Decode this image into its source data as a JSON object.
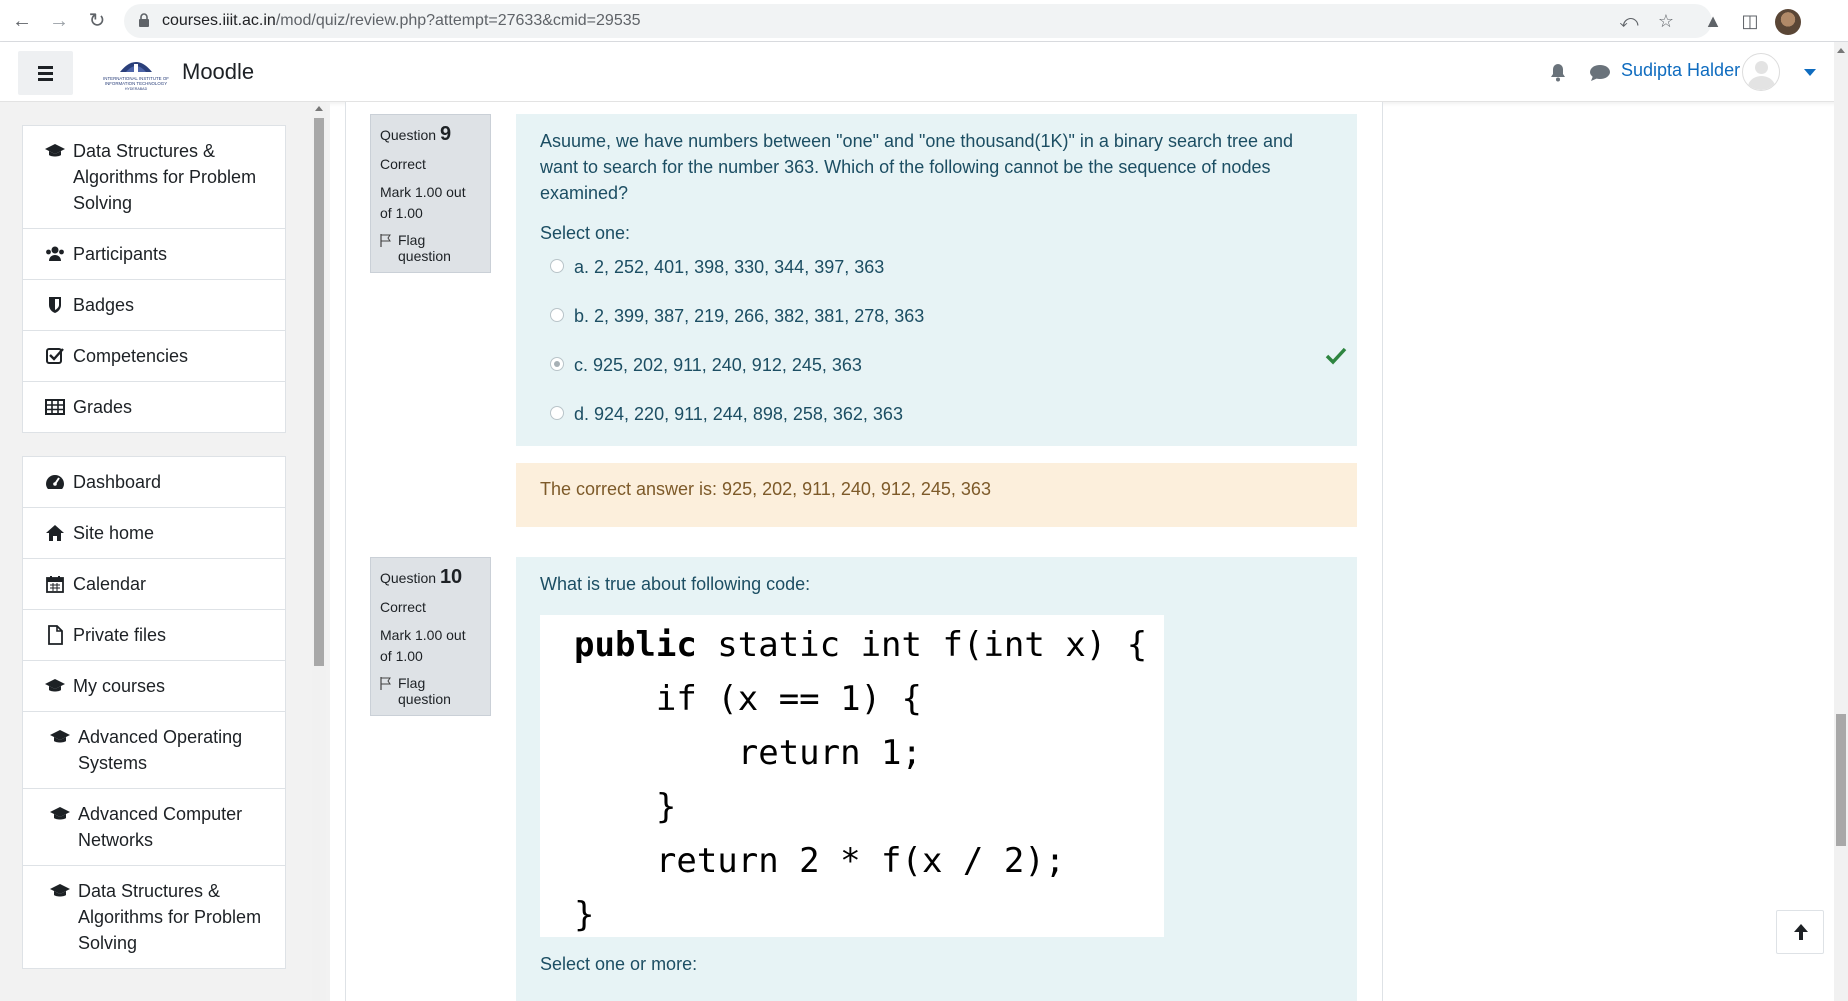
{
  "browser": {
    "url_host": "courses.iiit.ac.in",
    "url_path": "/mod/quiz/review.php?attempt=27633&cmid=29535"
  },
  "navbar": {
    "brand": "Moodle",
    "user_name": "Sudipta Halder",
    "logo_lines": [
      "INTERNATIONAL INSTITUTE OF",
      "INFORMATION TECHNOLOGY",
      "HYDERABAD"
    ]
  },
  "drawer": {
    "course_items": [
      {
        "label": "Data Structures & Algorithms for Problem Solving",
        "icon": "graduation-cap-icon"
      },
      {
        "label": "Participants",
        "icon": "users-icon"
      },
      {
        "label": "Badges",
        "icon": "badge-shield-icon"
      },
      {
        "label": "Competencies",
        "icon": "check-square-icon"
      },
      {
        "label": "Grades",
        "icon": "table-icon"
      }
    ],
    "site_items": [
      {
        "label": "Dashboard",
        "icon": "tachometer-icon"
      },
      {
        "label": "Site home",
        "icon": "home-icon"
      },
      {
        "label": "Calendar",
        "icon": "calendar-icon"
      },
      {
        "label": "Private files",
        "icon": "file-icon"
      },
      {
        "label": "My courses",
        "icon": "graduation-cap-icon"
      },
      {
        "label": "Advanced Operating Systems",
        "icon": "graduation-cap-icon"
      },
      {
        "label": "Advanced Computer Networks",
        "icon": "graduation-cap-icon"
      },
      {
        "label": "Data Structures & Algorithms for Problem Solving",
        "icon": "graduation-cap-icon"
      }
    ]
  },
  "questions": [
    {
      "label": "Question",
      "number": "9",
      "state": "Correct",
      "grade": "Mark 1.00 out of 1.00",
      "flag": "Flag question",
      "text": "Asuume, we have numbers between \"one\" and \"one thousand(1K)\" in a binary search tree and want to search for the number 363. Which of the following cannot be the sequence of nodes examined?",
      "prompt": "Select one:",
      "options": [
        "a. 2, 252, 401, 398, 330, 344, 397, 363",
        "b. 2, 399, 387, 219, 266, 382, 381, 278, 363",
        "c. 925, 202, 911, 240, 912, 245, 363",
        "d. 924, 220, 911, 244, 898, 258, 362, 363"
      ],
      "selected": 2,
      "correct_answer": "The correct answer is: 925, 202, 911, 240, 912, 245, 363"
    },
    {
      "label": "Question",
      "number": "10",
      "state": "Correct",
      "grade": "Mark 1.00 out of 1.00",
      "flag": "Flag question",
      "text": "What is true about following code:",
      "code": {
        "line1_kw": "public",
        "line1_rest": " static int f(int x) {",
        "line2": "    if (x == 1) {",
        "line3": "        return 1;",
        "line4": "    }",
        "line5": "    return 2 * f(x / 2);",
        "line6": "}"
      },
      "prompt": "Select one or more:"
    }
  ],
  "colors": {
    "link": "#0f6cbf",
    "formulation_bg": "#e7f3f5",
    "outcome_bg": "#fcefdc",
    "correct_tick": "#2e8540"
  }
}
